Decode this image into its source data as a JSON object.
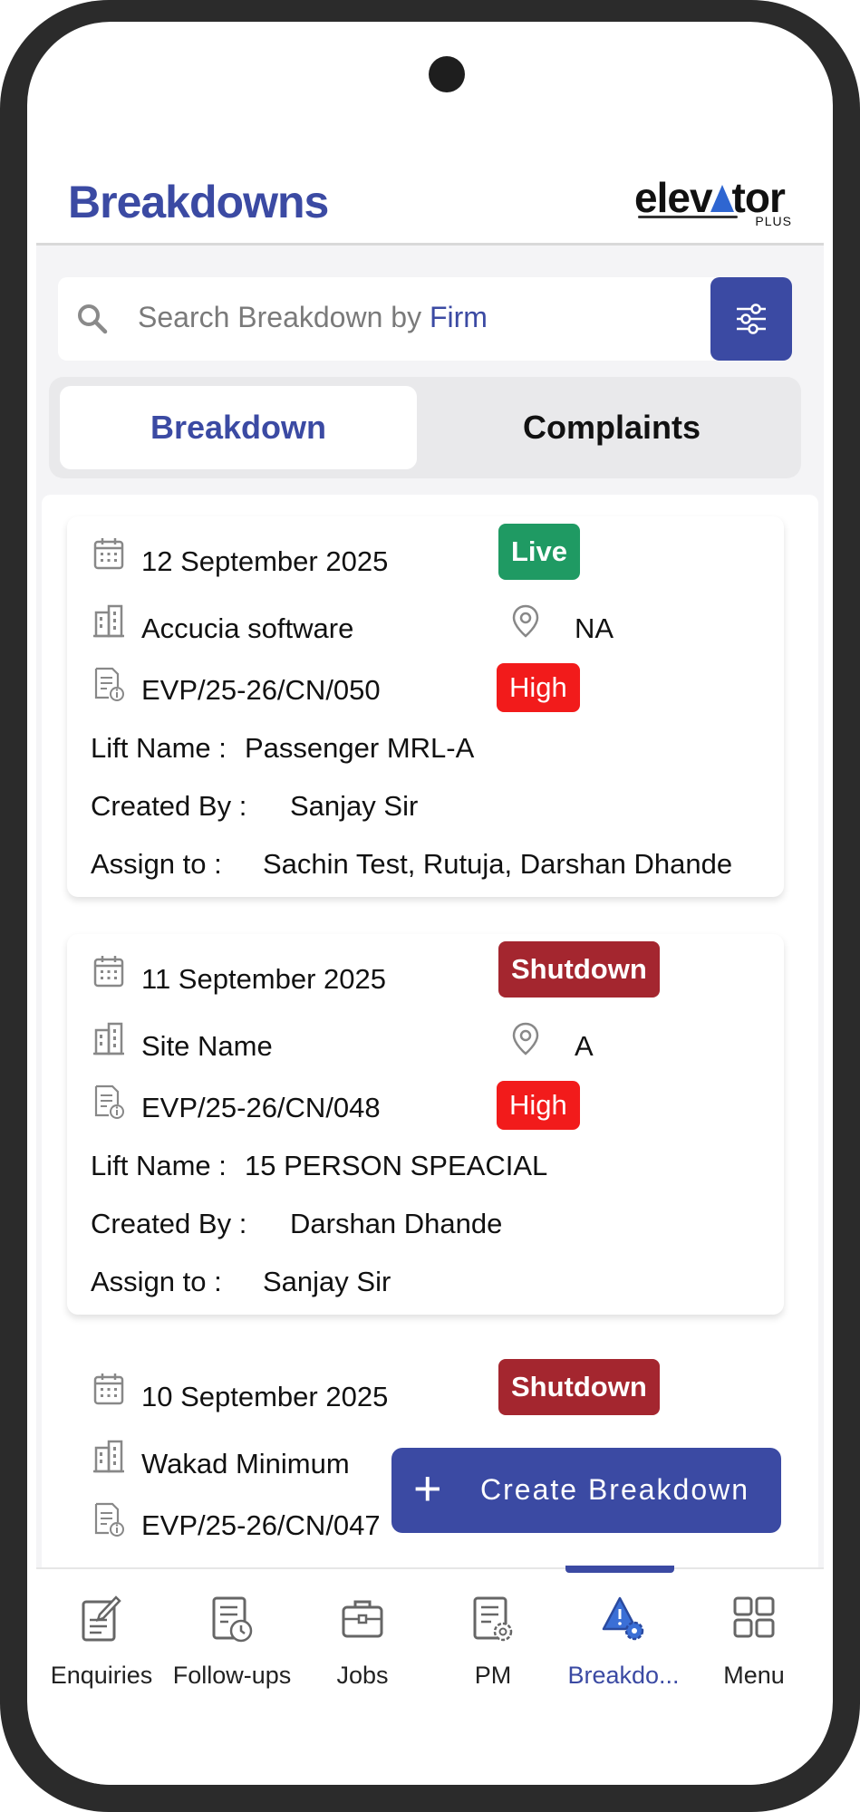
{
  "header": {
    "title": "Breakdowns",
    "logo_text_left": "elev",
    "logo_text_right": "tor",
    "logo_sub": "PLUS"
  },
  "search": {
    "placeholder_prefix": "Search Breakdown by ",
    "placeholder_highlight": "Firm"
  },
  "tabs": [
    {
      "label": "Breakdown",
      "active": true
    },
    {
      "label": "Complaints",
      "active": false
    }
  ],
  "cards": [
    {
      "date": "12 September 2025",
      "status": "Live",
      "site": "Accucia software",
      "location": "NA",
      "code": "EVP/25-26/CN/050",
      "priority": "High",
      "lift_label": "Lift Name :",
      "lift_value": "Passenger MRL-A",
      "created_label": "Created By :",
      "created_value": "Sanjay Sir",
      "assign_label": "Assign to :",
      "assign_value": "Sachin Test, Rutuja, Darshan Dhande"
    },
    {
      "date": "11 September 2025",
      "status": "Shutdown",
      "site": "Site Name",
      "location": "A",
      "code": "EVP/25-26/CN/048",
      "priority": "High",
      "lift_label": "Lift Name :",
      "lift_value": "15 PERSON SPEACIAL",
      "created_label": "Created By :",
      "created_value": "Darshan Dhande",
      "assign_label": "Assign to :",
      "assign_value": "Sanjay Sir"
    },
    {
      "date": "10 September 2025",
      "status": "Shutdown",
      "site": "Wakad Minimum",
      "code": "EVP/25-26/CN/047"
    }
  ],
  "fab": {
    "plus": "+",
    "label": "Create Breakdown"
  },
  "nav": [
    {
      "label": "Enquiries",
      "icon": "enquiries-icon"
    },
    {
      "label": "Follow-ups",
      "icon": "follow-ups-icon"
    },
    {
      "label": "Jobs",
      "icon": "briefcase-icon"
    },
    {
      "label": "PM",
      "icon": "pm-document-gear-icon"
    },
    {
      "label": "Breakdo...",
      "icon": "breakdown-warning-icon",
      "active": true
    },
    {
      "label": "Menu",
      "icon": "grid-menu-icon"
    }
  ],
  "colors": {
    "primary": "#3b4aa3",
    "live": "#1f9a63",
    "shutdown": "#a4262f",
    "high": "#f21b1b"
  }
}
